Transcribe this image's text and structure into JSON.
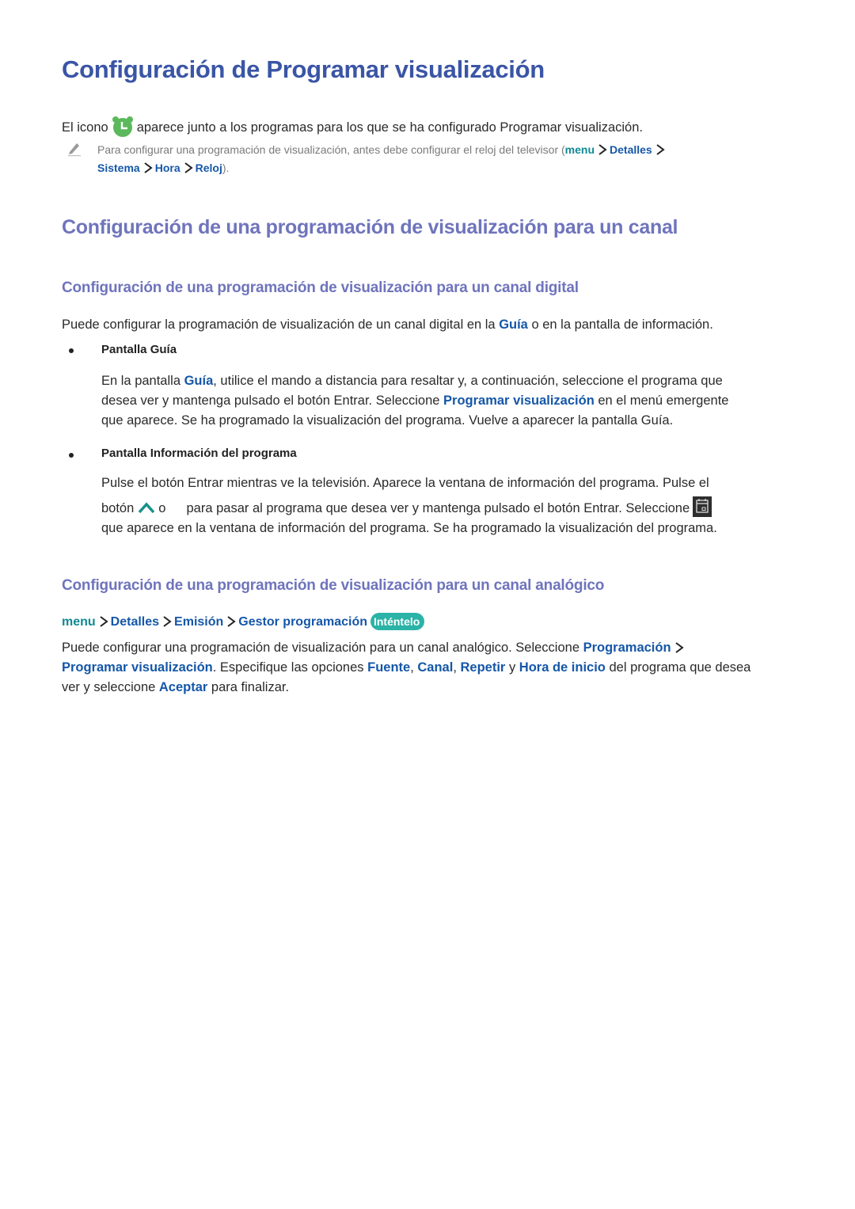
{
  "page_title": "Configuración de Programar visualización",
  "intro": {
    "before_icon": "El icono",
    "icon": "alarm-clock-icon",
    "after_icon": "aparece junto a los programas para los que se ha configurado Programar visualización."
  },
  "note": {
    "icon": "pencil-icon",
    "text": "Para configurar una programación de visualización, antes debe configurar el reloj del televisor (",
    "path": [
      "menu",
      "Detalles",
      "Sistema",
      "Hora",
      "Reloj"
    ],
    "end": ")."
  },
  "section_heading": "Configuración de una programación de visualización para un canal",
  "digital": {
    "heading": "Configuración de una programación de visualización para un canal digital",
    "intro_a": "Puede configurar la programación de visualización de un canal digital en la ",
    "intro_link": "Guía",
    "intro_b": " o en la pantalla de información.",
    "bullets": [
      {
        "title": "Pantalla Guía",
        "l1_a": "En la pantalla ",
        "l1_link": "Guía",
        "l1_b": ", utilice el mando a distancia para resaltar y, a continuación, seleccione el programa que",
        "l2_a": "desea ver y mantenga pulsado el botón Entrar. Seleccione ",
        "l2_link": "Programar visualización",
        "l2_b": " en el menú emergente",
        "l3": "que aparece. Se ha programado la visualización del programa. Vuelve a aparecer la pantalla Guía."
      },
      {
        "title": "Pantalla Información del programa",
        "l1": "Pulse el botón Entrar mientras ve la televisión. Aparece la ventana de información del programa. Pulse el",
        "l2_a": "botón",
        "l2_or": "o",
        "l2_b": "para pasar al programa que desea ver y mantenga pulsado el botón Entrar. Seleccione",
        "l3": "que aparece en la ventana de información del programa. Se ha programado la visualización del programa."
      }
    ]
  },
  "analog": {
    "heading": "Configuración de una programación de visualización para un canal analógico",
    "path": [
      "menu",
      "Detalles",
      "Emisión",
      "Gestor programación"
    ],
    "try_badge": "Inténtelo",
    "l1_a": "Puede configurar una programación de visualización para un canal analógico. Seleccione ",
    "l1_link": "Programación",
    "l2_link1": "Programar visualización",
    "l2_a": ". Especifique las opciones ",
    "opt1": "Fuente",
    "sep1": ", ",
    "opt2": "Canal",
    "sep2": ", ",
    "opt3": "Repetir",
    "sep3": " y ",
    "opt4": "Hora de inicio",
    "l2_b": " del programa que desea",
    "l3_a": "ver y seleccione ",
    "l3_link": "Aceptar",
    "l3_b": " para finalizar."
  },
  "colors": {
    "title": "#3a55a5",
    "subheading": "#6f74bc",
    "link": "#1557a8",
    "menu_link": "#0f8a95",
    "badge": "#2ab3a6",
    "alarm_icon": "#5cb85c"
  }
}
